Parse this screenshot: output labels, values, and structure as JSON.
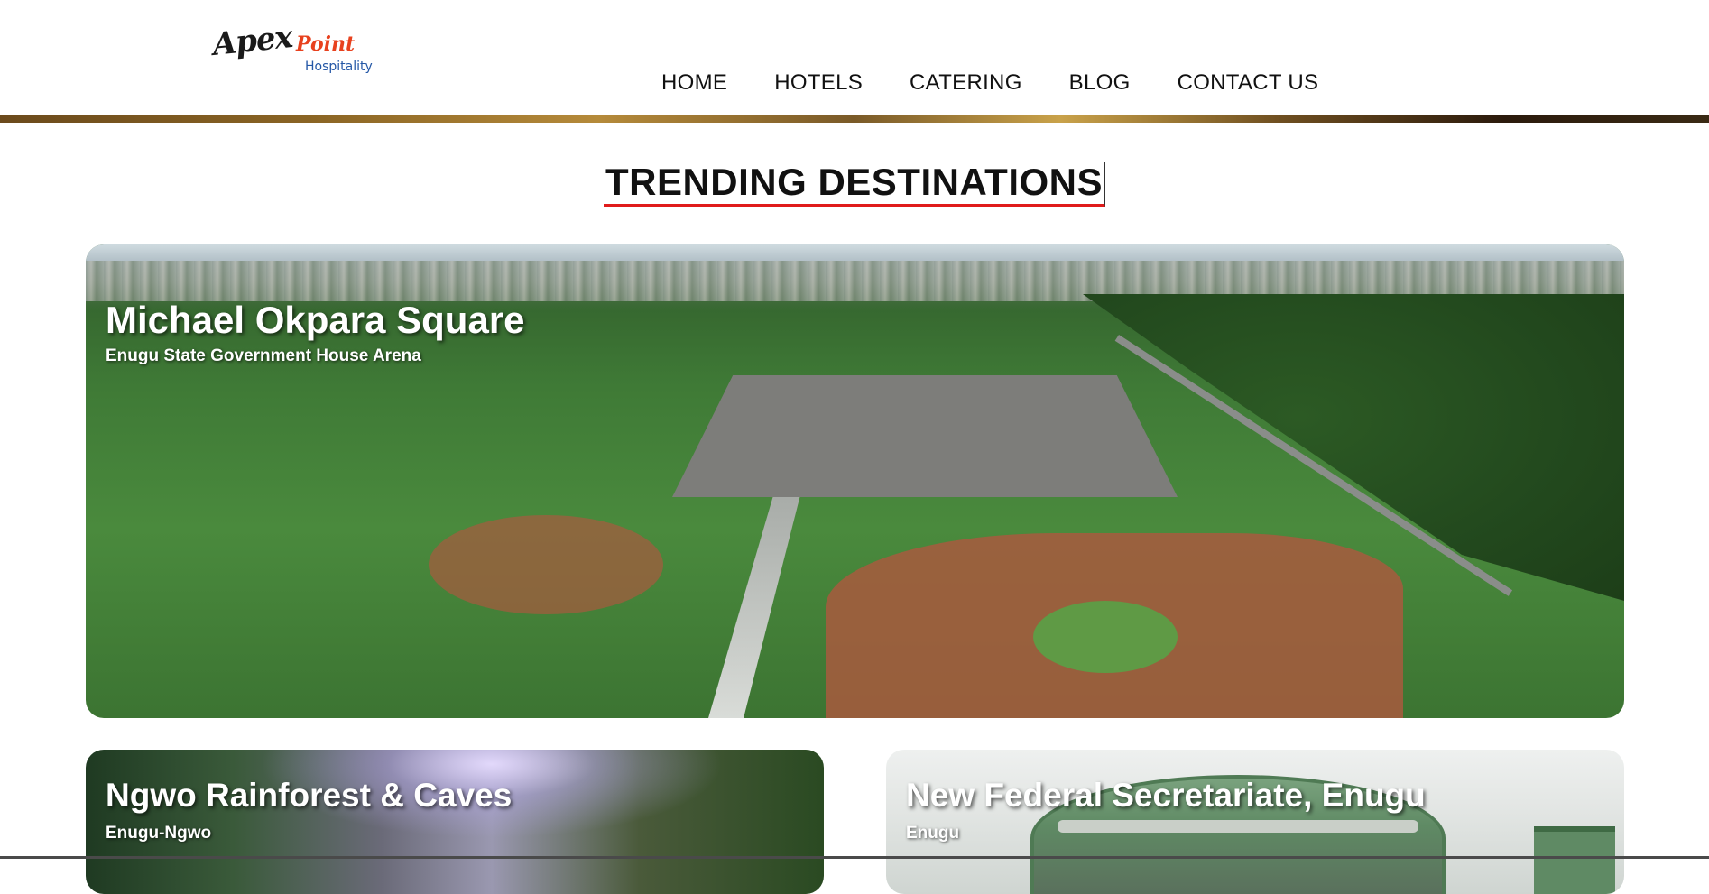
{
  "header": {
    "logo": {
      "word1": "Apex",
      "word2": "Point",
      "tagline": "Hospitality"
    },
    "nav": [
      {
        "label": "HOME"
      },
      {
        "label": "HOTELS"
      },
      {
        "label": "CATERING"
      },
      {
        "label": "BLOG"
      },
      {
        "label": "CONTACT US"
      }
    ]
  },
  "section": {
    "title": "TRENDING DESTINATIONS"
  },
  "destinations": [
    {
      "title": "Michael Okpara Square",
      "subtitle": "Enugu State Government House Arena"
    },
    {
      "title": "Ngwo Rainforest & Caves",
      "subtitle": "Enugu-Ngwo"
    },
    {
      "title": "New Federal Secretariate, Enugu",
      "subtitle": "Enugu"
    }
  ],
  "colors": {
    "title_underline": "#e01b1b",
    "logo_accent": "#e8411e",
    "logo_tagline": "#2457a6"
  }
}
